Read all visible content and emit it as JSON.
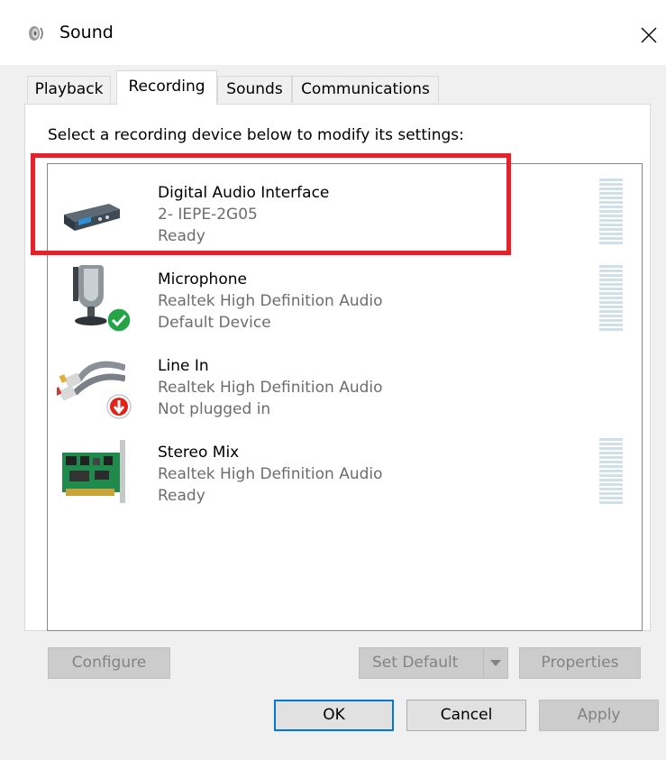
{
  "window": {
    "title": "Sound",
    "close_glyph": "✕",
    "icon": "speaker-icon"
  },
  "tabs": [
    {
      "label": "Playback",
      "active": false
    },
    {
      "label": "Recording",
      "active": true
    },
    {
      "label": "Sounds",
      "active": false
    },
    {
      "label": "Communications",
      "active": false
    }
  ],
  "instruction": "Select a recording device below to modify its settings:",
  "devices": [
    {
      "name": "Digital Audio Interface",
      "description": "2- IEPE-2G05",
      "status": "Ready",
      "icon": "audio-interface-icon",
      "level_meter": true,
      "highlighted": true
    },
    {
      "name": "Microphone",
      "description": "Realtek High Definition Audio",
      "status": "Default Device",
      "icon": "microphone-icon",
      "badge": "check-badge-icon",
      "level_meter": true
    },
    {
      "name": "Line In",
      "description": "Realtek High Definition Audio",
      "status": "Not plugged in",
      "icon": "line-in-cable-icon",
      "badge": "unplugged-badge-icon",
      "level_meter": false
    },
    {
      "name": "Stereo Mix",
      "description": "Realtek High Definition Audio",
      "status": "Ready",
      "icon": "sound-card-icon",
      "level_meter": true
    }
  ],
  "buttons": {
    "configure": "Configure",
    "set_default": "Set Default",
    "properties": "Properties",
    "ok": "OK",
    "cancel": "Cancel",
    "apply": "Apply"
  },
  "colors": {
    "highlight": "#e8202a",
    "accent": "#0078d7",
    "check": "#23a545",
    "unplugged": "#e2231a"
  }
}
